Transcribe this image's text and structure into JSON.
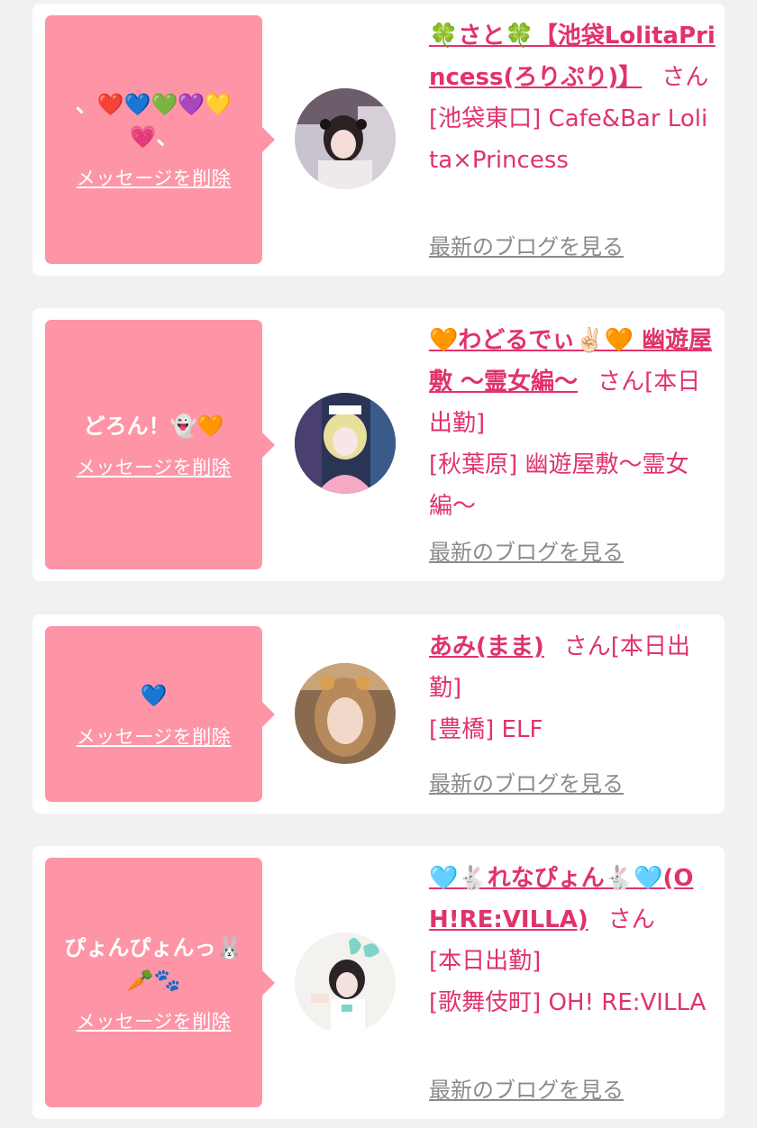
{
  "cards": [
    {
      "message": "、❤️💙💚💜💛💗、",
      "delete_label": "メッセージを削除",
      "name": "🍀さと🍀【池袋LolitaPrincess(ろりぷり)】",
      "suffix": "さん",
      "status": "",
      "shop": "[池袋東口] Cafe&Bar Lolita×Princess",
      "blog_label": "最新のブログを見る"
    },
    {
      "message": "どろん！👻🧡",
      "delete_label": "メッセージを削除",
      "name": "🧡わどるでぃ✌🏻🧡 幽遊屋敷 〜霊女編〜",
      "suffix": "さん",
      "status": "[本日出勤]",
      "shop": "[秋葉原] 幽遊屋敷〜霊女編〜",
      "blog_label": "最新のブログを見る"
    },
    {
      "message": "💙",
      "delete_label": "メッセージを削除",
      "name": "あみ(まま)",
      "suffix": "さん",
      "status": "[本日出勤]",
      "shop": "[豊橋] ELF",
      "blog_label": "最新のブログを見る"
    },
    {
      "message": "ぴょんぴょんっ🐰🥕🐾",
      "delete_label": "メッセージを削除",
      "name": "🩵🐇れなぴょん🐇🩵(OH!RE:VILLA)",
      "suffix": "さん",
      "status": "[本日出勤]",
      "shop": "[歌舞伎町] OH! RE:VILLA",
      "blog_label": "最新のブログを見る"
    }
  ]
}
